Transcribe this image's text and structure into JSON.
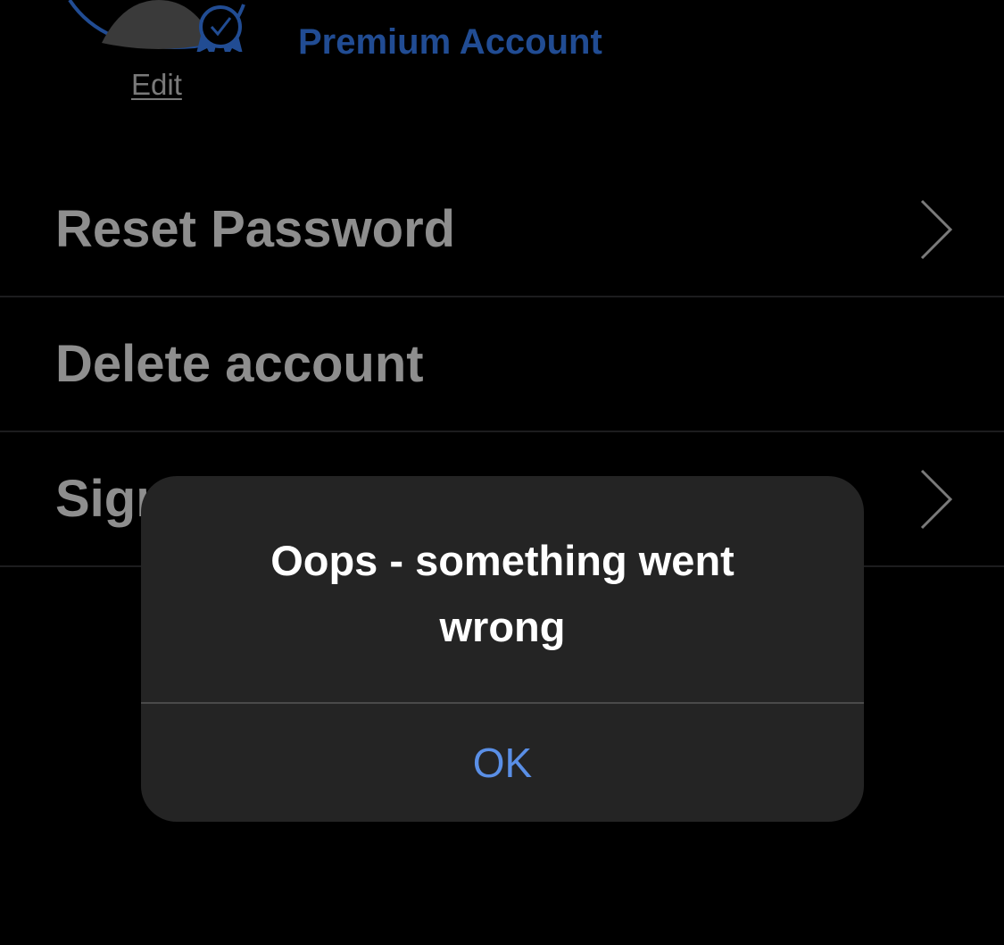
{
  "header": {
    "edit_label": "Edit",
    "account_type": "Premium Account",
    "avatar_icon": "avatar-with-verified-badge-icon",
    "accent_color": "#214c93"
  },
  "menu": {
    "items": [
      {
        "label": "Reset Password",
        "icon": "chevron-right-icon"
      },
      {
        "label": "Delete account"
      },
      {
        "label": "Sign",
        "icon": "chevron-right-icon"
      }
    ]
  },
  "alert": {
    "title": "Oops - something went wrong",
    "button_label": "OK",
    "button_color": "#5a8fe6"
  }
}
